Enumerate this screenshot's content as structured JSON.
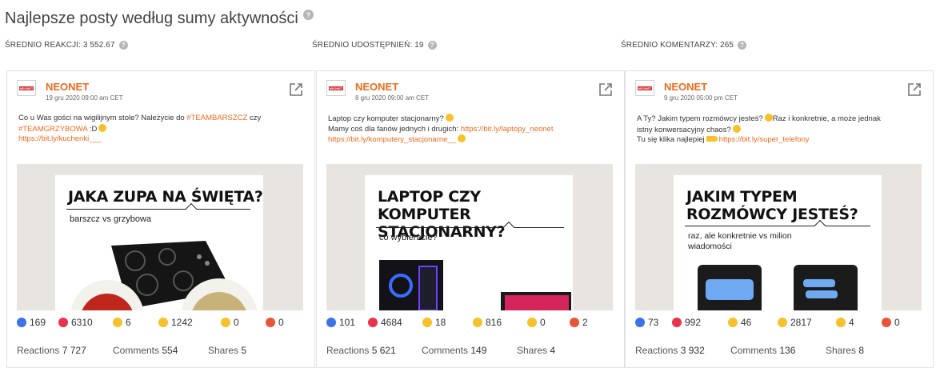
{
  "title": "Najlepsze posty według sumy aktywności",
  "stats": [
    {
      "label": "ŚREDNIO REAKCJI: 3 552.67"
    },
    {
      "label": "ŚREDNIO UDOSTĘPNIEŃ: 19"
    },
    {
      "label": "ŚREDNIO KOMENTARZY: 265"
    }
  ],
  "help_glyph": "?",
  "logo_text": "NEONET",
  "posts": [
    {
      "author": "NEONET",
      "date": "19 gru 2020 09:00 am CET",
      "text1": "Co u Was gości na wigilijnym stole? Należycie do ",
      "tag1": "#TEAMBARSZCZ",
      "text2": " czy",
      "tag2": "#TEAMGRZYBOWA",
      "text3": " :D",
      "link": "https://bit.ly/kuchenki___",
      "headline": "JAKA ZUPA NA ŚWIĘTA?",
      "sub": "barszcz vs grzybowa",
      "reactions": {
        "like": "169",
        "love": "6310",
        "haha": "6",
        "wow": "1242",
        "sad": "0",
        "angry": "0"
      },
      "summary": {
        "reactions_label": "Reactions",
        "reactions": "7 727",
        "comments_label": "Comments",
        "comments": "554",
        "shares_label": "Shares",
        "shares": "5"
      }
    },
    {
      "author": "NEONET",
      "date": "8 gru 2020 09:00 am CET",
      "line1": "Laptop czy komputer stacjonarny?",
      "line2": "Mamy coś dla fanów jednych i drugich: ",
      "link1": "https://bit.ly/laptopy_neonet",
      "link2": "https://bit.ly/komputery_stacjonarne__",
      "headline": "LAPTOP CZY\nKOMPUTER STACJONARNY?",
      "sub": "co wybieracie?",
      "reactions": {
        "like": "101",
        "love": "4684",
        "haha": "18",
        "wow": "816",
        "sad": "0",
        "angry": "2"
      },
      "summary": {
        "reactions_label": "Reactions",
        "reactions": "5 621",
        "comments_label": "Comments",
        "comments": "149",
        "shares_label": "Shares",
        "shares": "4"
      }
    },
    {
      "author": "NEONET",
      "date": "9 gru 2020 05:00 pm CET",
      "line1": "A Ty? Jakim typem rozmówcy jesteś?",
      "line1b": "Raz i konkretnie, a może jednak",
      "line2": "istny konwersacyjny chaos?",
      "line3": "Tu się klika najlepiej",
      "link": "https://bit.ly/super_telefony",
      "headline": "JAKIM TYPEM\nROZMÓWCY JESTEŚ?",
      "sub": "raz, ale konkretnie vs milion\nwiadomości",
      "reactions": {
        "like": "73",
        "love": "992",
        "haha": "46",
        "wow": "2817",
        "sad": "4",
        "angry": "0"
      },
      "summary": {
        "reactions_label": "Reactions",
        "reactions": "3 932",
        "comments_label": "Comments",
        "comments": "136",
        "shares_label": "Shares",
        "shares": "8"
      }
    }
  ],
  "colors": {
    "brand_orange": "#ee6a1c",
    "like": "#3d72e8",
    "love": "#e8334a",
    "haha": "#f6c12b",
    "angry": "#e8533a"
  }
}
